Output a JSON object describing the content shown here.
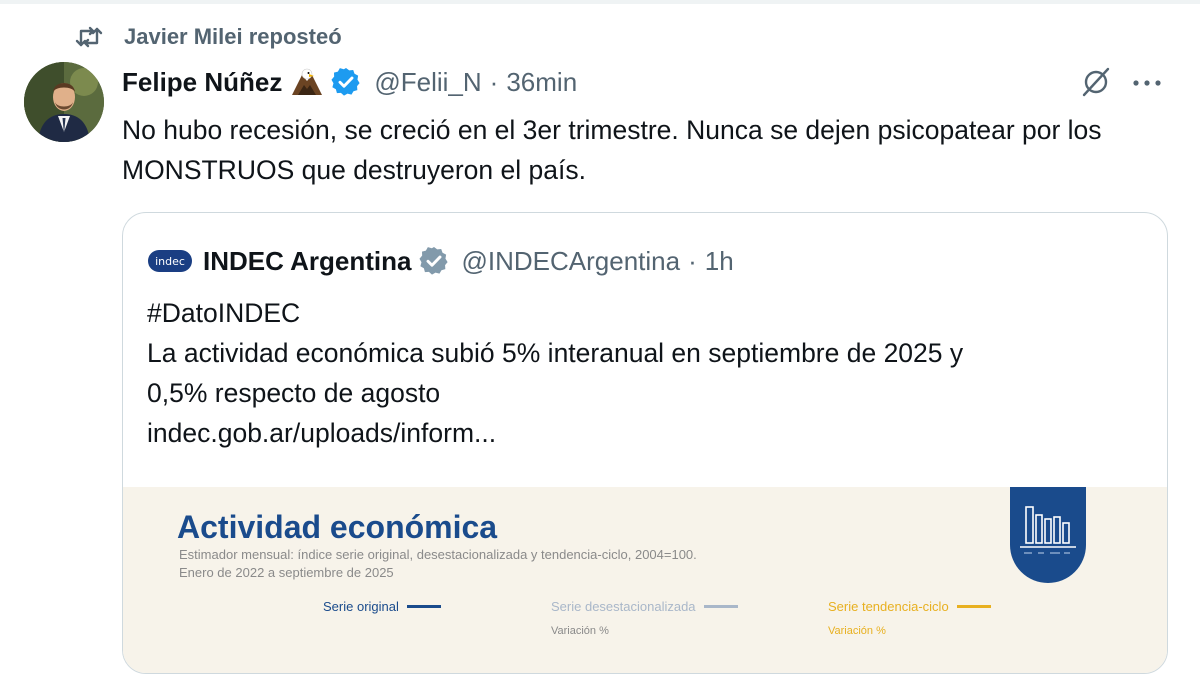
{
  "repost": {
    "label": "Javier Milei reposteó",
    "icon": "repost-icon"
  },
  "tweet": {
    "author_name": "Felipe Núñez",
    "emoji": "eagle-emoji",
    "handle": "@Felii_N",
    "separator": "·",
    "time": "36min",
    "text": "No hubo recesión, se creció en el 3er trimestre. Nunca se dejen psicopatear por los MONSTRUOS que destruyeron el país."
  },
  "quote": {
    "logo_text": "indec",
    "author_name": "INDEC Argentina",
    "handle": "@INDECArgentina",
    "separator": "·",
    "time": "1h",
    "lines": [
      "#DatoINDEC",
      "La actividad económica subió 5% interanual en septiembre de 2025 y",
      "0,5% respecto de agosto",
      "indec.gob.ar/uploads/inform..."
    ],
    "image": {
      "title": "Actividad económica",
      "subtitle1": "Estimador mensual: índice serie original, desestacionalizada y tendencia-ciclo, 2004=100.",
      "subtitle2": "Enero de 2022 a septiembre de 2025",
      "legend": [
        {
          "label": "Serie original",
          "color": "#1a4b8c"
        },
        {
          "label": "Serie desestacionalizada",
          "color": "#a9b7c9"
        },
        {
          "label": "Serie tendencia-ciclo",
          "color": "#e8b020"
        }
      ],
      "variation_label": "Variación %"
    }
  },
  "colors": {
    "text": "#0f1419",
    "secondary": "#536471",
    "verified": "#1d9bf0",
    "org_verified": "#829aab",
    "indec_blue": "#1a4b8c"
  }
}
